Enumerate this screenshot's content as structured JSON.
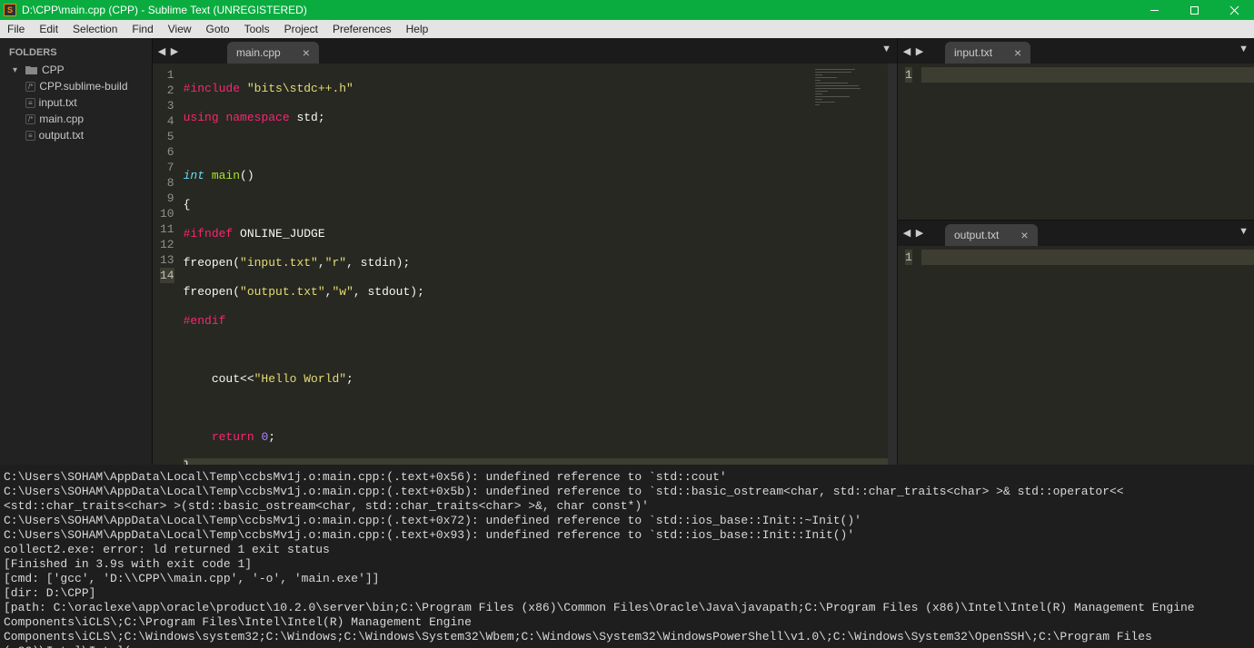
{
  "window": {
    "title": "D:\\CPP\\main.cpp (CPP) - Sublime Text (UNREGISTERED)"
  },
  "menu": [
    "File",
    "Edit",
    "Selection",
    "Find",
    "View",
    "Goto",
    "Tools",
    "Project",
    "Preferences",
    "Help"
  ],
  "sidebar": {
    "header": "FOLDERS",
    "root": "CPP",
    "items": [
      {
        "name": "CPP.sublime-build",
        "ext": "/*"
      },
      {
        "name": "input.txt",
        "ext": "≡"
      },
      {
        "name": "main.cpp",
        "ext": "/*"
      },
      {
        "name": "output.txt",
        "ext": "≡"
      }
    ]
  },
  "left_pane": {
    "tab_label": "main.cpp",
    "line_numbers": [
      "1",
      "2",
      "3",
      "4",
      "5",
      "6",
      "7",
      "8",
      "9",
      "10",
      "11",
      "12",
      "13",
      "14"
    ],
    "current_line": 14,
    "code": {
      "l1": {
        "a": "#include",
        "b": "\"bits\\stdc++.h\""
      },
      "l2": {
        "a": "using",
        "b": "namespace",
        "c": " std;"
      },
      "l4": {
        "a": "int",
        "b": " ",
        "c": "main",
        "d": "()"
      },
      "l5": "{",
      "l6": {
        "a": "#ifndef",
        "b": " ONLINE_JUDGE"
      },
      "l7": {
        "a": "freopen",
        "b": "(",
        "c": "\"input.txt\"",
        "d": ",",
        "e": "\"r\"",
        "f": ", stdin);"
      },
      "l8": {
        "a": "freopen",
        "b": "(",
        "c": "\"output.txt\"",
        "d": ",",
        "e": "\"w\"",
        "f": ", stdout);"
      },
      "l9": "#endif",
      "l11": {
        "a": "    cout<<",
        "b": "\"Hello World\"",
        "c": ";"
      },
      "l13": {
        "a": "    ",
        "b": "return",
        "c": " ",
        "d": "0",
        "e": ";"
      },
      "l14": "}"
    }
  },
  "right_top": {
    "tab_label": "input.txt",
    "line_numbers": [
      "1"
    ]
  },
  "right_bottom": {
    "tab_label": "output.txt",
    "line_numbers": [
      "1"
    ]
  },
  "console": "C:\\Users\\SOHAM\\AppData\\Local\\Temp\\ccbsMv1j.o:main.cpp:(.text+0x56): undefined reference to `std::cout'\nC:\\Users\\SOHAM\\AppData\\Local\\Temp\\ccbsMv1j.o:main.cpp:(.text+0x5b): undefined reference to `std::basic_ostream<char, std::char_traits<char> >& std::operator<< <std::char_traits<char> >(std::basic_ostream<char, std::char_traits<char> >&, char const*)'\nC:\\Users\\SOHAM\\AppData\\Local\\Temp\\ccbsMv1j.o:main.cpp:(.text+0x72): undefined reference to `std::ios_base::Init::~Init()'\nC:\\Users\\SOHAM\\AppData\\Local\\Temp\\ccbsMv1j.o:main.cpp:(.text+0x93): undefined reference to `std::ios_base::Init::Init()'\ncollect2.exe: error: ld returned 1 exit status\n[Finished in 3.9s with exit code 1]\n[cmd: ['gcc', 'D:\\\\CPP\\\\main.cpp', '-o', 'main.exe']]\n[dir: D:\\CPP]\n[path: C:\\oraclexe\\app\\oracle\\product\\10.2.0\\server\\bin;C:\\Program Files (x86)\\Common Files\\Oracle\\Java\\javapath;C:\\Program Files (x86)\\Intel\\Intel(R) Management Engine Components\\iCLS\\;C:\\Program Files\\Intel\\Intel(R) Management Engine Components\\iCLS\\;C:\\Windows\\system32;C:\\Windows;C:\\Windows\\System32\\Wbem;C:\\Windows\\System32\\WindowsPowerShell\\v1.0\\;C:\\Windows\\System32\\OpenSSH\\;C:\\Program Files (x86)\\Intel\\Intel("
}
